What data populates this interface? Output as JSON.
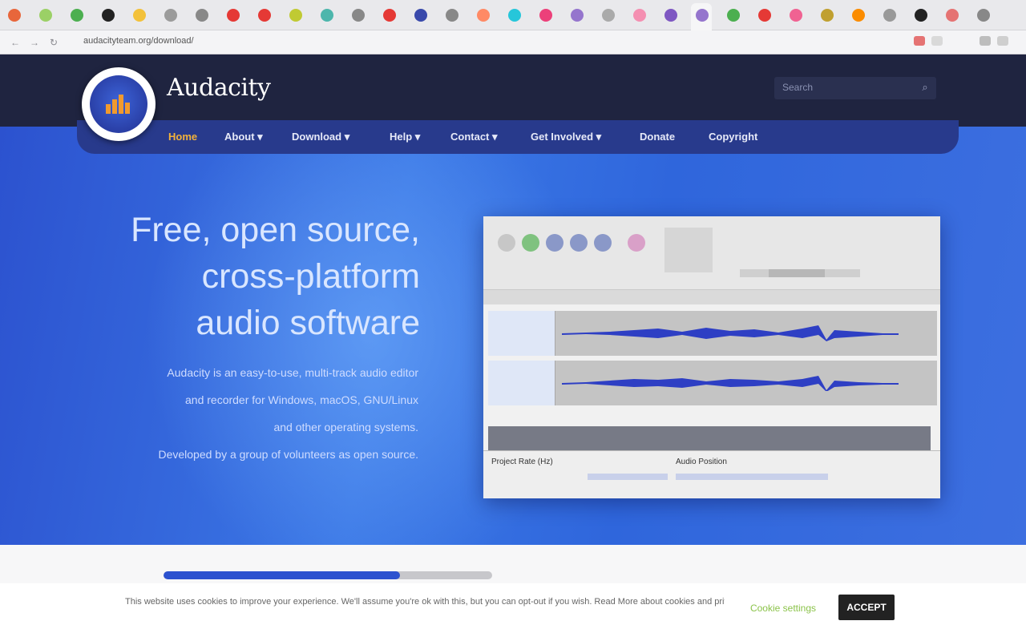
{
  "browser": {
    "url": "audacityteam.org/download/",
    "tab_favicon_colors": [
      "#e8663b",
      "#9bd066",
      "#4caf50",
      "#222222",
      "#f3c13a",
      "#9b9b9b",
      "#888888",
      "#e53935",
      "#e53935",
      "#c0ca33",
      "#4db6ac",
      "#888888",
      "#e53935",
      "#3949ab",
      "#888888",
      "#ff8a65",
      "#26c6da",
      "#ec407a",
      "#9575cd",
      "#aaaaaa",
      "#f48fb1",
      "#7e57c2",
      "#9575cd",
      "#4caf50",
      "#e53935",
      "#f06292",
      "#c0a030",
      "#fb8c00",
      "#999999",
      "#222222",
      "#e57373",
      "#888888"
    ]
  },
  "header": {
    "brand": "Audacity",
    "search_placeholder": "Search",
    "nav": [
      {
        "label": "Home",
        "active": true
      },
      {
        "label": "About ▾",
        "active": false
      },
      {
        "label": "Download ▾",
        "active": false
      },
      {
        "label": "Help ▾",
        "active": false
      },
      {
        "label": "Contact ▾",
        "active": false
      },
      {
        "label": "Get Involved ▾",
        "active": false
      },
      {
        "label": "Donate",
        "active": false
      },
      {
        "label": "Copyright",
        "active": false
      }
    ]
  },
  "hero": {
    "title_line1": "Free, open source,",
    "title_line2": "cross-platform",
    "title_line3": "audio software",
    "desc_line1": "Audacity is an easy-to-use, multi-track audio editor",
    "desc_line2": "and recorder for Windows, macOS, GNU/Linux",
    "desc_line3": "and other operating systems.",
    "desc_line4": "Developed by a group of volunteers as open source."
  },
  "screenshot": {
    "selection_label_1": "Project Rate (Hz)",
    "selection_label_2": "Audio Position"
  },
  "download_progress": 0.72,
  "cookie": {
    "text": "This website uses cookies to improve your experience. We'll assume you're ok with this, but you can opt-out if you wish. Read More about cookies and privacy policy.",
    "settings_label": "Cookie settings",
    "accept_label": "ACCEPT"
  },
  "colors": {
    "header_bg": "#1f2440",
    "nav_bg": "#283a8c",
    "hero_blue": "#3b78e6",
    "nav_active": "#f3b23a",
    "wave_blue": "#2e3fc4"
  }
}
